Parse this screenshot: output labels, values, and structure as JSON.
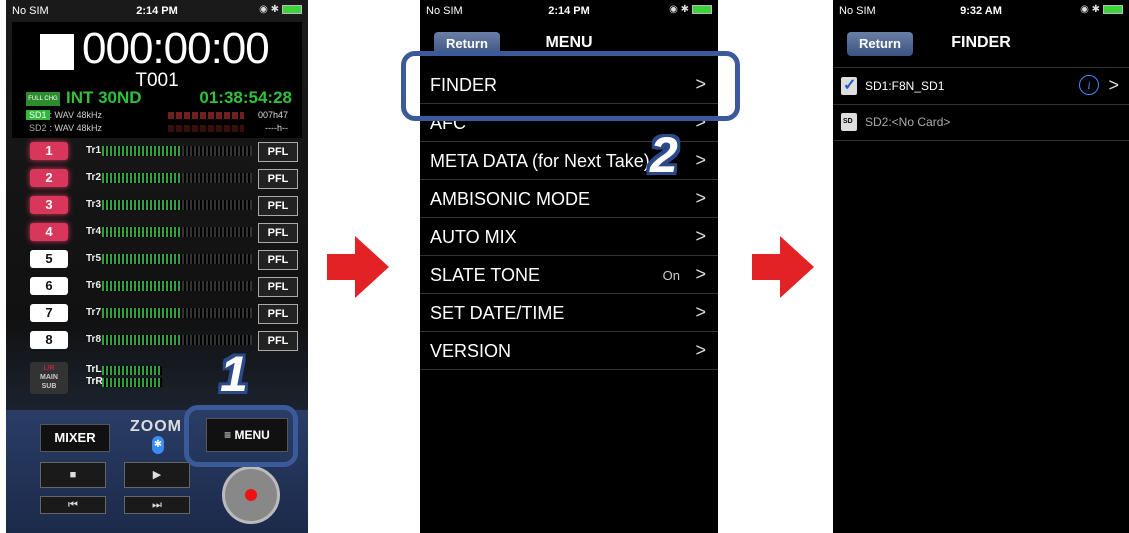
{
  "colors": {
    "arrow": "#e32226",
    "callout": "#3a5a9a",
    "rec_track": "#d8365a",
    "level_green": "#2fc23a"
  },
  "step1": {
    "status": {
      "carrier": "No SIM",
      "time": "2:14 PM"
    },
    "timecode": "000:00:00",
    "take": "T001",
    "batt_badge": "FULL CHG",
    "input_info": "INT 30ND",
    "remaining_time": "01:38:54:28",
    "sd1": {
      "tag": "SD1",
      "format": ": WAV 48kHz",
      "remain": "007h47"
    },
    "sd2": {
      "tag": "SD2",
      "format": ": WAV 48kHz",
      "remain": "----h--"
    },
    "tracks": [
      {
        "num": "1",
        "label": "Tr1",
        "pfl": "PFL"
      },
      {
        "num": "2",
        "label": "Tr2",
        "pfl": "PFL"
      },
      {
        "num": "3",
        "label": "Tr3",
        "pfl": "PFL"
      },
      {
        "num": "4",
        "label": "Tr4",
        "pfl": "PFL"
      },
      {
        "num": "5",
        "label": "Tr5",
        "pfl": "PFL"
      },
      {
        "num": "6",
        "label": "Tr6",
        "pfl": "PFL"
      },
      {
        "num": "7",
        "label": "Tr7",
        "pfl": "PFL"
      },
      {
        "num": "8",
        "label": "Tr8",
        "pfl": "PFL"
      }
    ],
    "lr": {
      "btn_top": "L/R",
      "btn_mid": "MAIN",
      "btn_bot": "SUB",
      "trl": "TrL",
      "trr": "TrR"
    },
    "mixer_label": "MIXER",
    "menu_label": "≡ MENU",
    "logo": "ZOOM",
    "transport": {
      "stop": "■",
      "play": "▶",
      "prev": "⏮",
      "next": "⏭"
    },
    "callout_num": "1"
  },
  "step2": {
    "status": {
      "carrier": "No SIM",
      "time": "2:14 PM"
    },
    "title": "MENU",
    "return_label": "Return",
    "items": [
      {
        "label": "FINDER",
        "value": ""
      },
      {
        "label": "AFC",
        "value": ""
      },
      {
        "label": "META DATA (for Next Take)",
        "value": ""
      },
      {
        "label": "AMBISONIC MODE",
        "value": ""
      },
      {
        "label": "AUTO MIX",
        "value": ""
      },
      {
        "label": "SLATE TONE",
        "value": "On"
      },
      {
        "label": "SET DATE/TIME",
        "value": ""
      },
      {
        "label": "VERSION",
        "value": ""
      }
    ],
    "chevron": ">",
    "callout_num": "2"
  },
  "step3": {
    "status": {
      "carrier": "No SIM",
      "time": "9:32 AM"
    },
    "title": "FINDER",
    "return_label": "Return",
    "rows": [
      {
        "label": "SD1:F8N_SD1"
      },
      {
        "label": "SD2:<No Card>"
      }
    ],
    "info": "i",
    "chevron": ">"
  }
}
